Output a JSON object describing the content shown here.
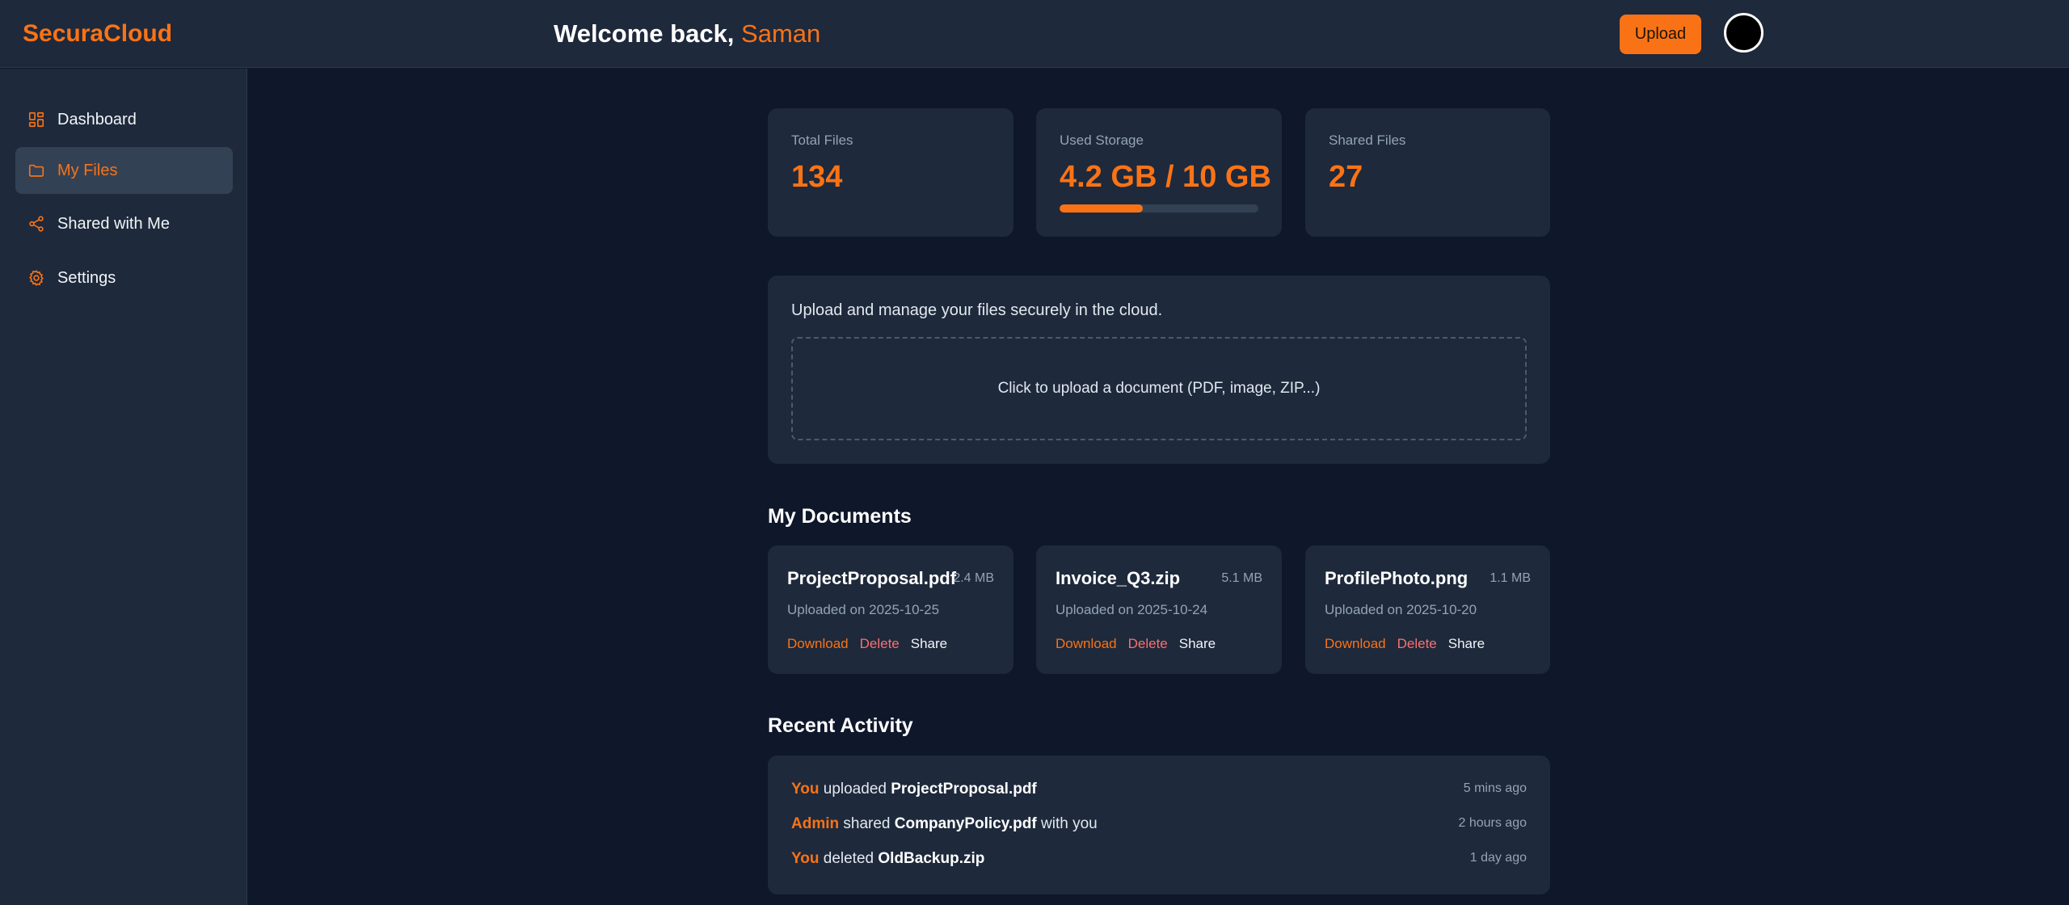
{
  "header": {
    "brand": "SecuraCloud",
    "welcome_prefix": "Welcome back, ",
    "user_name": "Saman",
    "upload_label": "Upload"
  },
  "sidebar": {
    "items": [
      {
        "label": "Dashboard",
        "icon": "dashboard-grid-icon",
        "active": false
      },
      {
        "label": "My Files",
        "icon": "folder-icon",
        "active": true
      },
      {
        "label": "Shared with Me",
        "icon": "share-icon",
        "active": false
      },
      {
        "label": "Settings",
        "icon": "gear-icon",
        "active": false
      }
    ]
  },
  "stats": {
    "total_files": {
      "label": "Total Files",
      "value": "134"
    },
    "used_storage": {
      "label": "Used Storage",
      "value": "4.2 GB / 10 GB",
      "fraction": 0.42
    },
    "shared_files": {
      "label": "Shared Files",
      "value": "27"
    }
  },
  "upload": {
    "description": "Upload and manage your files securely in the cloud.",
    "dropzone_text": "Click to upload a document (PDF, image, ZIP...)"
  },
  "documents": {
    "title": "My Documents",
    "actions": {
      "download": "Download",
      "delete": "Delete",
      "share": "Share"
    },
    "items": [
      {
        "name": "ProjectProposal.pdf",
        "size": "2.4 MB",
        "date": "Uploaded on 2025-10-25"
      },
      {
        "name": "Invoice_Q3.zip",
        "size": "5.1 MB",
        "date": "Uploaded on 2025-10-24"
      },
      {
        "name": "ProfilePhoto.png",
        "size": "1.1 MB",
        "date": "Uploaded on 2025-10-20"
      }
    ]
  },
  "activity": {
    "title": "Recent Activity",
    "items": [
      {
        "who": "You",
        "verb": " uploaded ",
        "file": "ProjectProposal.pdf",
        "suffix": "",
        "time": "5 mins ago"
      },
      {
        "who": "Admin",
        "verb": " shared ",
        "file": "CompanyPolicy.pdf",
        "suffix": " with you",
        "time": "2 hours ago"
      },
      {
        "who": "You",
        "verb": " deleted ",
        "file": "OldBackup.zip",
        "suffix": "",
        "time": "1 day ago"
      }
    ]
  },
  "colors": {
    "accent": "#f97316",
    "danger": "#f87171",
    "background": "#0f172a",
    "surface": "#1e293b"
  }
}
